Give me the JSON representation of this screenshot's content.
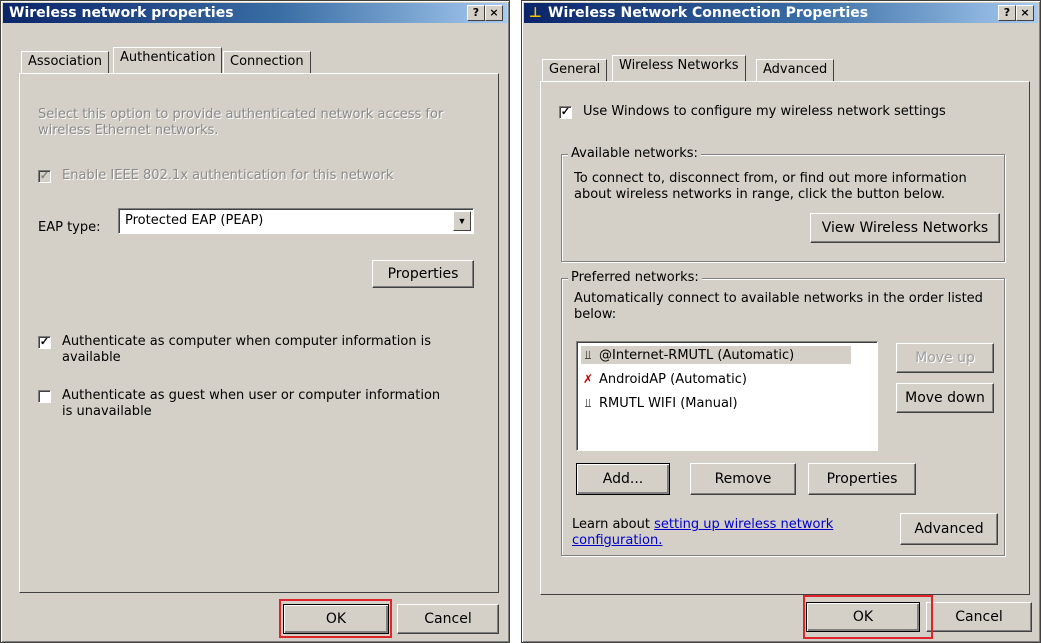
{
  "left_dialog": {
    "title": "Wireless network properties",
    "help_btn": "?",
    "close_btn": "×",
    "tabs": [
      "Association",
      "Authentication",
      "Connection"
    ],
    "active_tab": "Authentication",
    "description": "Select this option to provide authenticated network access for wireless Ethernet networks.",
    "enable_8021x": {
      "label": "Enable IEEE 802.1x authentication for this network",
      "checked": true,
      "disabled": true
    },
    "eap_type_label": "EAP type:",
    "eap_type_value": "Protected EAP (PEAP)",
    "properties_button": "Properties",
    "auth_computer": {
      "label": "Authenticate as computer when computer information is available",
      "checked": true
    },
    "auth_guest": {
      "label": "Authenticate as guest when user or computer information is unavailable",
      "checked": false
    },
    "ok_button": "OK",
    "cancel_button": "Cancel"
  },
  "right_dialog": {
    "title": "Wireless Network Connection Properties",
    "help_btn": "?",
    "close_btn": "×",
    "tabs": [
      "General",
      "Wireless Networks",
      "Advanced"
    ],
    "active_tab": "Wireless Networks",
    "use_windows": {
      "label": "Use Windows to configure my wireless network settings",
      "checked": true
    },
    "available_networks": {
      "legend": "Available networks:",
      "description": "To connect to, disconnect from, or find out more information about wireless networks in range, click the button below.",
      "view_button": "View Wireless Networks"
    },
    "preferred_networks": {
      "legend": "Preferred networks:",
      "description": "Automatically connect to available networks in the order listed below:",
      "items": [
        {
          "label": "@Internet-RMUTL (Automatic)",
          "icon": "antenna-icon",
          "selected": true
        },
        {
          "label": "AndroidAP (Automatic)",
          "icon": "antenna-error-icon",
          "selected": false
        },
        {
          "label": "RMUTL WIFI (Manual)",
          "icon": "antenna-icon",
          "selected": false
        }
      ],
      "move_up": "Move up",
      "move_down": "Move down",
      "add_button": "Add...",
      "remove_button": "Remove",
      "properties_button": "Properties"
    },
    "learn_prefix": "Learn about ",
    "learn_link": "setting up wireless network configuration.",
    "advanced_button": "Advanced",
    "ok_button": "OK",
    "cancel_button": "Cancel"
  },
  "colors": {
    "dialog_bg": "#d4d0c8",
    "title_start": "#0a246a",
    "title_end": "#a6caf0",
    "highlight": "#e0242c",
    "link": "#0000cc"
  }
}
